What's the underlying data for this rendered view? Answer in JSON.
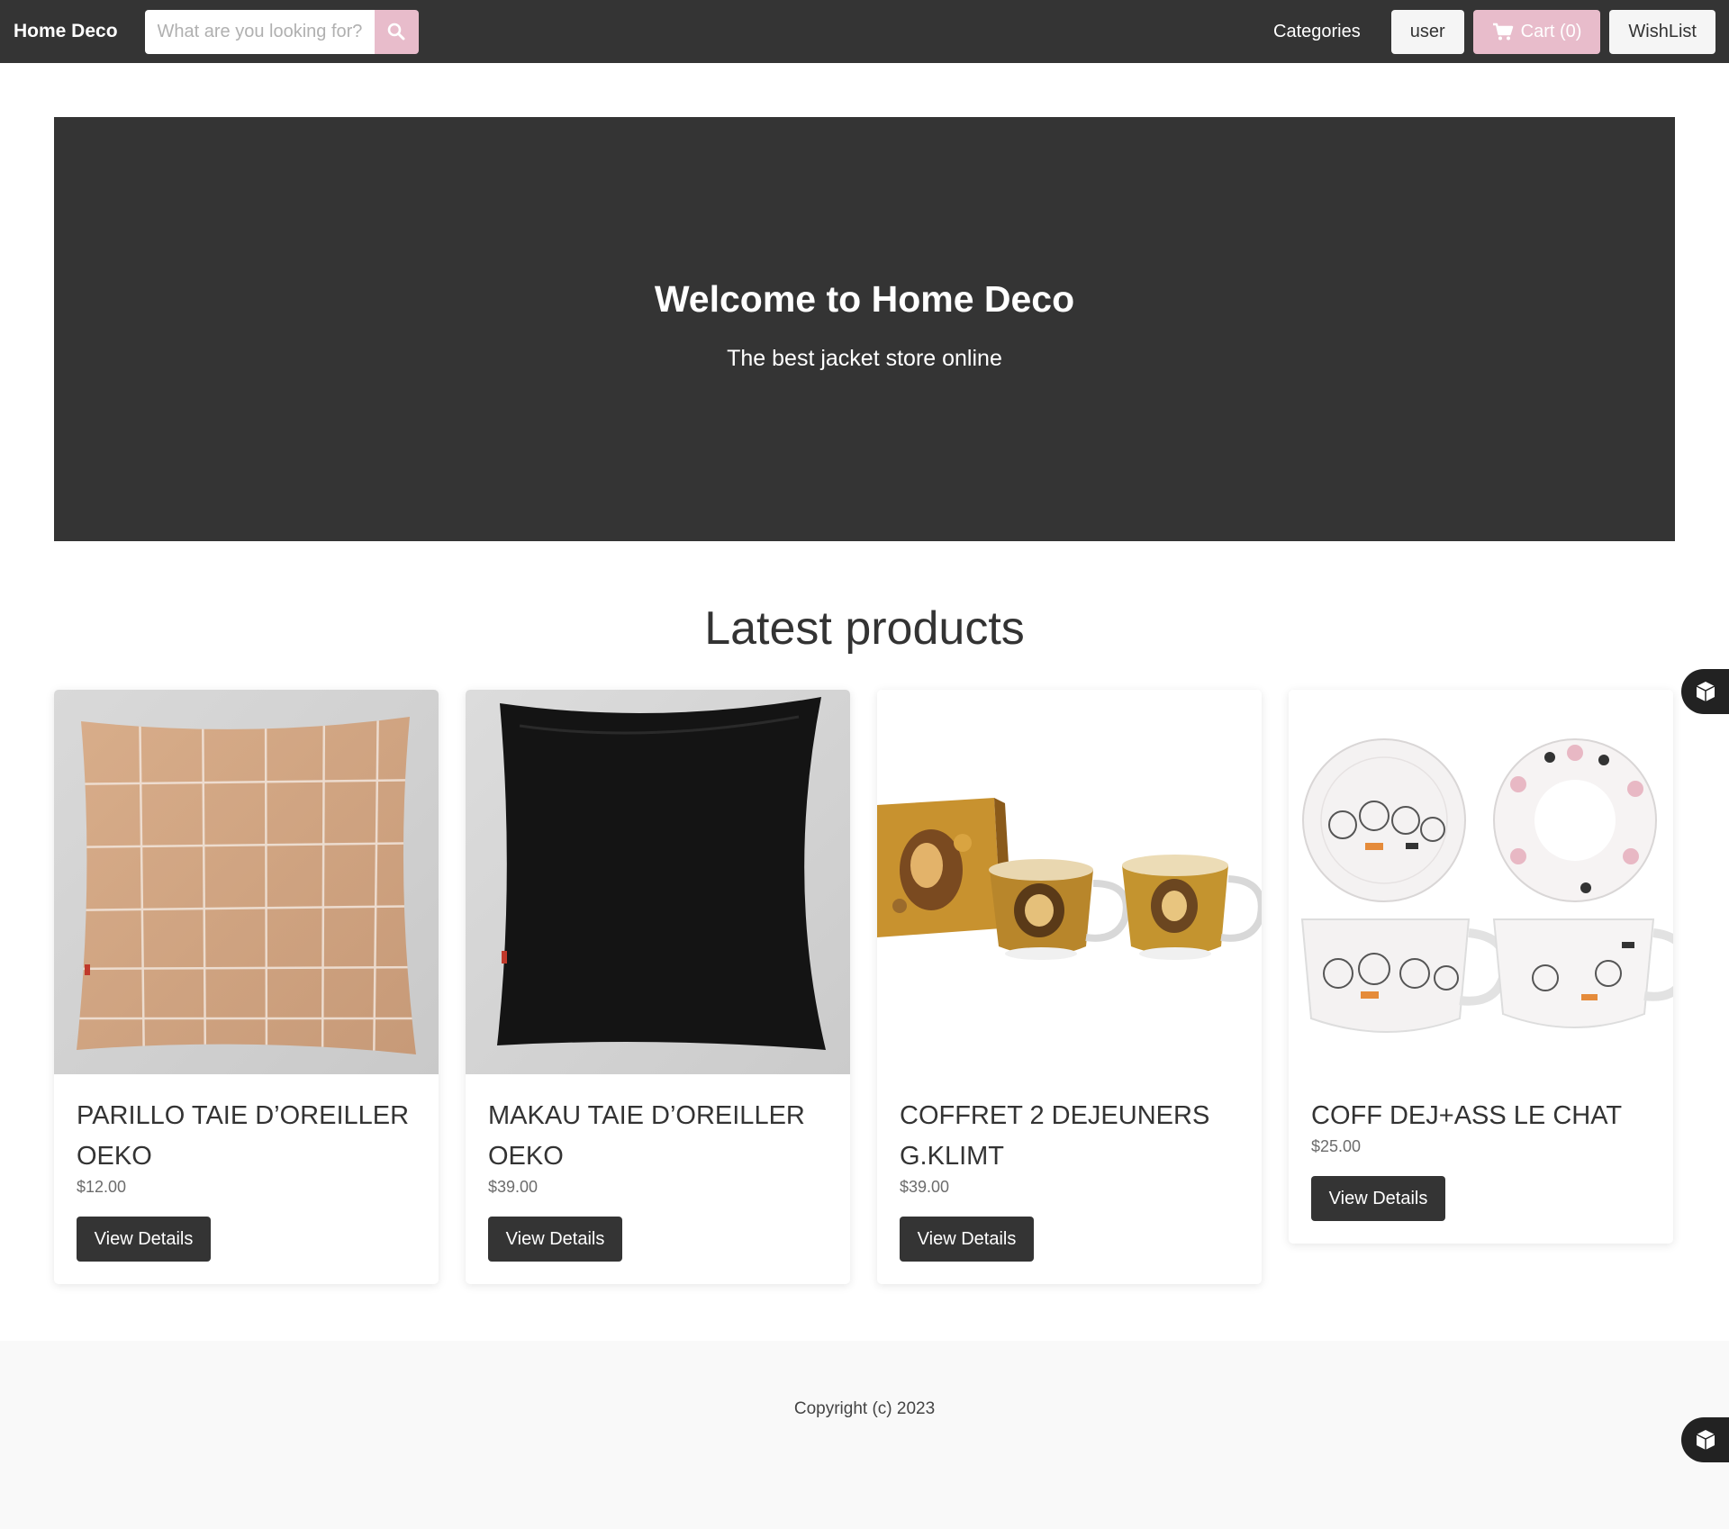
{
  "navbar": {
    "brand": "Home Deco",
    "search_placeholder": "What are you looking for?",
    "categories_label": "Categories",
    "user_label": "user",
    "cart_label": "Cart (0)",
    "wishlist_label": "WishList"
  },
  "hero": {
    "title": "Welcome to Home Deco",
    "subtitle": "The best jacket store online"
  },
  "section": {
    "title": "Latest products"
  },
  "products": [
    {
      "title": "PARILLO TAIE D’OREILLER OEKO",
      "price": "$12.00",
      "button": "View Details"
    },
    {
      "title": "MAKAU TAIE D’OREILLER OEKO",
      "price": "$39.00",
      "button": "View Details"
    },
    {
      "title": "COFFRET 2 DEJEUNERS G.KLIMT",
      "price": "$39.00",
      "button": "View Details"
    },
    {
      "title": "COFF DEJ+ASS LE CHAT",
      "price": "$25.00",
      "button": "View Details"
    }
  ],
  "footer": {
    "copyright": "Copyright (c) 2023"
  },
  "colors": {
    "navbar_bg": "#343434",
    "accent_pink": "#e8bccb",
    "footer_bg": "#f9f9f9"
  }
}
